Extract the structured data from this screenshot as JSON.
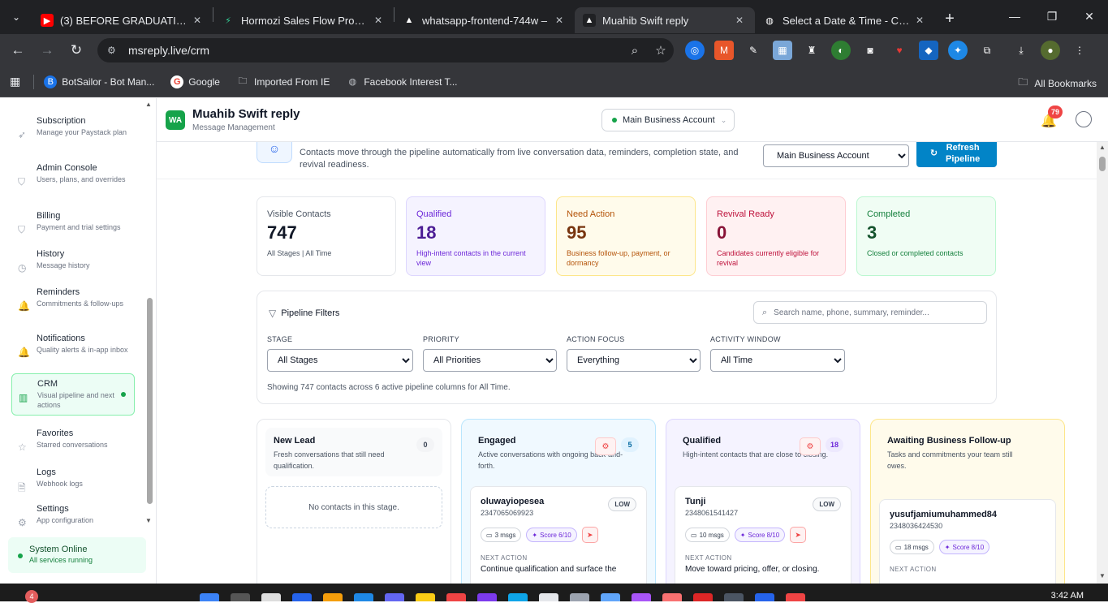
{
  "browser": {
    "tabs": [
      {
        "label": "(3) BEFORE GRADUATION - C",
        "fav_color": "#ff0000",
        "fav_glyph": "▶",
        "active": false
      },
      {
        "label": "Hormozi Sales Flow Prompt",
        "fav_color": "#202124",
        "fav_glyph": "⚡",
        "active": false
      },
      {
        "label": "whatsapp-frontend-744w –",
        "fav_color": "#202124",
        "fav_glyph": "▲",
        "active": false
      },
      {
        "label": "Muahib Swift reply",
        "fav_color": "#202124",
        "fav_glyph": "▲",
        "active": true
      },
      {
        "label": "Select a Date & Time - Calen",
        "fav_color": "#202124",
        "fav_glyph": "◍",
        "active": false
      }
    ],
    "url": "msreply.live/crm",
    "bookmarks": [
      "BotSailor - Bot Man...",
      "Google",
      "Imported From IE",
      "Facebook Interest T..."
    ],
    "all_bookmarks": "All Bookmarks"
  },
  "sidebar": {
    "items": [
      {
        "title": "Subscription",
        "sub": "Manage your Paystack plan",
        "icon": "rocket-icon",
        "glyph": "➶"
      },
      {
        "title": "Admin Console",
        "sub": "Users, plans, and overrides",
        "icon": "shield-icon",
        "glyph": "⛉"
      },
      {
        "title": "Billing",
        "sub": "Payment and trial settings",
        "icon": "shield-icon",
        "glyph": "⛉"
      },
      {
        "title": "History",
        "sub": "Message history",
        "icon": "clock-icon",
        "glyph": "◷"
      },
      {
        "title": "Reminders",
        "sub": "Commitments & follow-ups",
        "icon": "bell-icon",
        "glyph": "🔔"
      },
      {
        "title": "Notifications",
        "sub": "Quality alerts & in-app inbox",
        "icon": "bell-icon",
        "glyph": "🔔"
      },
      {
        "title": "CRM",
        "sub": "Visual pipeline and next actions",
        "icon": "kanban-icon",
        "glyph": "▥"
      },
      {
        "title": "Favorites",
        "sub": "Starred conversations",
        "icon": "star-icon",
        "glyph": "☆"
      },
      {
        "title": "Logs",
        "sub": "Webhook logs",
        "icon": "file-icon",
        "glyph": "🗎"
      },
      {
        "title": "Settings",
        "sub": "App configuration",
        "icon": "gear-icon",
        "glyph": "⚙"
      }
    ],
    "status_title": "System Online",
    "status_sub": "All services running"
  },
  "header": {
    "logo": "WA",
    "title": "Muahib Swift reply",
    "subtitle": "Message Management",
    "account": "Main Business Account",
    "notifications_count": "79"
  },
  "hero": {
    "description": "Contacts move through the pipeline automatically from live conversation data, reminders, completion state, and revival readiness.",
    "account_select": "Main Business Account",
    "refresh_label": "Refresh Pipeline"
  },
  "kpis": [
    {
      "label": "Visible Contacts",
      "value": "747",
      "desc": "All Stages | All Time",
      "bg": "#ffffff",
      "border": "#e5e7eb",
      "label_color": "#4b5563",
      "value_color": "#111827",
      "desc_color": "#4b5563"
    },
    {
      "label": "Qualified",
      "value": "18",
      "desc": "High-intent contacts in the current view",
      "bg": "#f5f3ff",
      "border": "#ddd6fe",
      "label_color": "#6d28d9",
      "value_color": "#4c1d95",
      "desc_color": "#6d28d9"
    },
    {
      "label": "Need Action",
      "value": "95",
      "desc": "Business follow-up, payment, or dormancy",
      "bg": "#fffbeb",
      "border": "#fde68a",
      "label_color": "#b45309",
      "value_color": "#78350f",
      "desc_color": "#b45309"
    },
    {
      "label": "Revival Ready",
      "value": "0",
      "desc": "Candidates currently eligible for revival",
      "bg": "#fff1f2",
      "border": "#fecdd3",
      "label_color": "#be123c",
      "value_color": "#881337",
      "desc_color": "#be123c"
    },
    {
      "label": "Completed",
      "value": "3",
      "desc": "Closed or completed contacts",
      "bg": "#f0fdf4",
      "border": "#bbf7d0",
      "label_color": "#15803d",
      "value_color": "#14532d",
      "desc_color": "#15803d"
    }
  ],
  "filters": {
    "title": "Pipeline Filters",
    "search_placeholder": "Search name, phone, summary, reminder...",
    "stage_label": "STAGE",
    "stage_value": "All Stages",
    "priority_label": "PRIORITY",
    "priority_value": "All Priorities",
    "focus_label": "ACTION FOCUS",
    "focus_value": "Everything",
    "window_label": "ACTIVITY WINDOW",
    "window_value": "All Time",
    "summary": "Showing 747 contacts across 6 active pipeline columns for All Time."
  },
  "columns": [
    {
      "title": "New Lead",
      "desc": "Fresh conversations that still need qualification.",
      "count": "0",
      "empty": "No contacts in this stage.",
      "bg": "#ffffff",
      "border": "#e5e7eb",
      "head_bg": "#f9fafb",
      "count_bg": "#f3f4f6",
      "count_color": "#374151"
    },
    {
      "title": "Engaged",
      "desc": "Active conversations with ongoing back-and-forth.",
      "count": "5",
      "bg": "#f0f9ff",
      "border": "#bae6fd",
      "head_bg": "#f0f9ff",
      "count_bg": "#e0f2fe",
      "count_color": "#0369a1",
      "card": {
        "name": "oluwayiopesea",
        "phone": "2347065069923",
        "priority": "LOW",
        "msgs": "3 msgs",
        "score": "Score 6/10",
        "next_label": "NEXT ACTION",
        "next": "Continue qualification and surface the"
      }
    },
    {
      "title": "Qualified",
      "desc": "High-intent contacts that are close to closing.",
      "count": "18",
      "bg": "#f5f3ff",
      "border": "#ddd6fe",
      "head_bg": "#f5f3ff",
      "count_bg": "#ede9fe",
      "count_color": "#6d28d9",
      "card": {
        "name": "Tunji",
        "phone": "2348061541427",
        "priority": "LOW",
        "msgs": "10 msgs",
        "score": "Score 8/10",
        "next_label": "NEXT ACTION",
        "next": "Move toward pricing, offer, or closing."
      }
    },
    {
      "title": "Awaiting Business Follow-up",
      "desc": "Tasks and commitments your team still owes.",
      "count": "",
      "bg": "#fffbeb",
      "border": "#fde68a",
      "head_bg": "#fffbeb",
      "count_bg": "#fef3c7",
      "count_color": "#b45309",
      "card": {
        "name": "yusufjamiumuhammed84",
        "phone": "2348036424530",
        "priority": "",
        "msgs": "18 msgs",
        "score": "Score 8/10",
        "next_label": "NEXT ACTION",
        "next": ""
      }
    }
  ],
  "taskbar": {
    "notif": "4",
    "time": "3:42 AM"
  }
}
